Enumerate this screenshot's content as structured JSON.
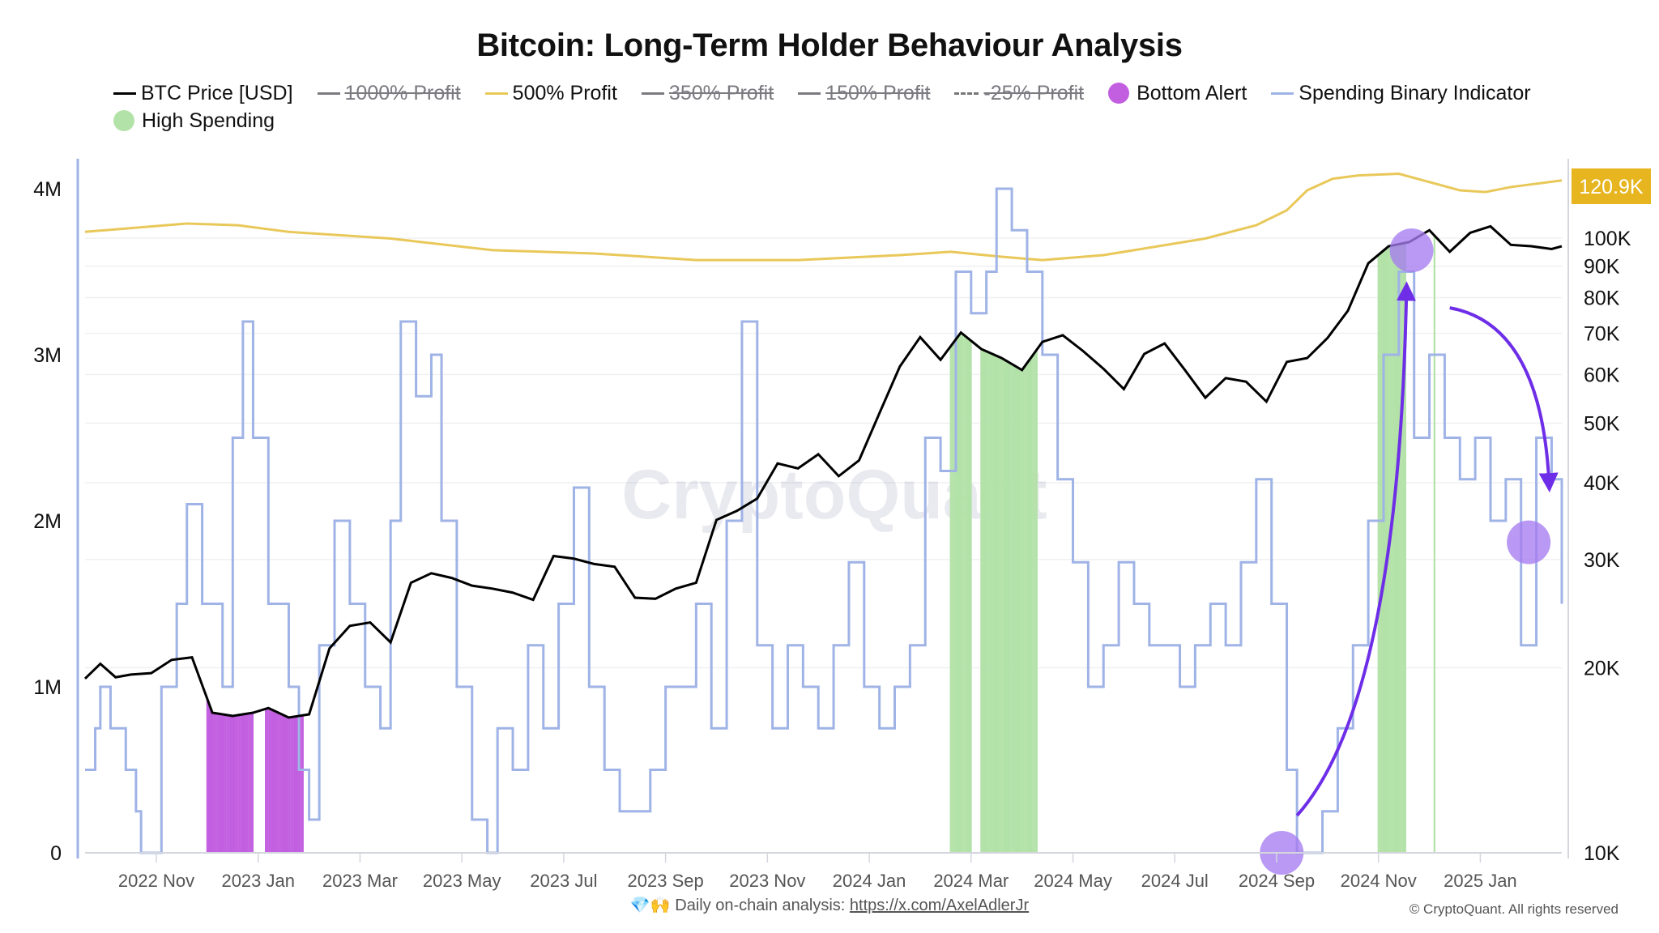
{
  "title": "Bitcoin: Long-Term Holder Behaviour Analysis",
  "legend": [
    {
      "label": "BTC Price [USD]",
      "style": "line",
      "color": "#000000",
      "active": true
    },
    {
      "label": "1000% Profit",
      "style": "line",
      "color": "#7a7a80",
      "active": false
    },
    {
      "label": "500% Profit",
      "style": "line",
      "color": "#e9c85a",
      "active": true
    },
    {
      "label": "350% Profit",
      "style": "line",
      "color": "#7a7a80",
      "active": false
    },
    {
      "label": "150% Profit",
      "style": "line",
      "color": "#7a7a80",
      "active": false
    },
    {
      "label": "-25% Profit",
      "style": "dashed",
      "color": "#7a7a80",
      "active": false
    },
    {
      "label": "Bottom Alert",
      "style": "dot",
      "color": "#c25ee0",
      "active": true
    },
    {
      "label": "Spending Binary Indicator",
      "style": "line",
      "color": "#9fb3e6",
      "active": true
    },
    {
      "label": "High Spending",
      "style": "dot",
      "color": "#b3e2a8",
      "active": true
    }
  ],
  "watermark": "CryptoQuant",
  "footer": {
    "emoji": "💎🙌",
    "text": "Daily on-chain analysis: ",
    "link_text": "https://x.com/AxelAdlerJr",
    "copyright": "© CryptoQuant. All rights reserved"
  },
  "price_badge": "120.9K",
  "colors": {
    "price": "#000000",
    "profit500": "#e9c85a",
    "spending": "#9fb3e6",
    "bottom_alert": "#c25ee0",
    "high_spending": "#b3e2a8",
    "annotation": "#6e2ee8",
    "annotation_circle": "#a57cf0",
    "badge": "#e6b51f"
  },
  "chart_data": {
    "type": "line",
    "title": "Bitcoin: Long-Term Holder Behaviour Analysis",
    "x_range": [
      "2022-09-20",
      "2025-02-20"
    ],
    "x_ticks": [
      "2022 Nov",
      "2023 Jan",
      "2023 Mar",
      "2023 May",
      "2023 Jul",
      "2023 Sep",
      "2023 Nov",
      "2024 Jan",
      "2024 Mar",
      "2024 May",
      "2024 Jul",
      "2024 Sep",
      "2024 Nov",
      "2025 Jan"
    ],
    "x_tick_months": [
      1.4,
      3.4,
      5.4,
      7.4,
      9.4,
      11.4,
      13.4,
      15.4,
      17.4,
      19.4,
      21.4,
      23.4,
      25.4,
      27.4
    ],
    "x_months_total": 29.0,
    "left_axis": {
      "label": "",
      "ticks": [
        "0",
        "1M",
        "2M",
        "3M",
        "4M"
      ],
      "tick_values": [
        0,
        1000000,
        2000000,
        3000000,
        4000000
      ],
      "range": [
        0,
        4000000
      ]
    },
    "right_axis": {
      "label": "",
      "scale": "log",
      "ticks": [
        "10K",
        "20K",
        "30K",
        "40K",
        "50K",
        "60K",
        "70K",
        "80K",
        "90K",
        "100K"
      ],
      "tick_values": [
        10000,
        20000,
        30000,
        40000,
        50000,
        60000,
        70000,
        80000,
        90000,
        100000
      ],
      "range": [
        10000,
        120000
      ]
    },
    "legend_position": "top",
    "series": [
      {
        "name": "BTC Price [USD]",
        "axis": "right",
        "x_months": [
          0.0,
          0.3,
          0.6,
          0.9,
          1.3,
          1.7,
          2.1,
          2.5,
          2.9,
          3.3,
          3.6,
          4.0,
          4.4,
          4.8,
          5.2,
          5.6,
          6.0,
          6.4,
          6.8,
          7.2,
          7.6,
          8.0,
          8.4,
          8.8,
          9.2,
          9.6,
          10.0,
          10.4,
          10.8,
          11.2,
          11.6,
          12.0,
          12.4,
          12.8,
          13.2,
          13.6,
          14.0,
          14.4,
          14.8,
          15.2,
          15.6,
          16.0,
          16.4,
          16.8,
          17.2,
          17.6,
          18.0,
          18.4,
          18.8,
          19.2,
          19.6,
          20.0,
          20.4,
          20.8,
          21.2,
          21.6,
          22.0,
          22.4,
          22.8,
          23.2,
          23.6,
          24.0,
          24.4,
          24.8,
          25.2,
          25.6,
          26.0,
          26.4,
          26.8,
          27.2,
          27.6,
          28.0,
          28.4,
          28.8,
          29.0
        ],
        "values": [
          19200,
          20300,
          19300,
          19500,
          19600,
          20600,
          20800,
          16900,
          16700,
          16900,
          17200,
          16600,
          16800,
          21500,
          23400,
          23700,
          22000,
          27500,
          28500,
          28000,
          27200,
          26900,
          26500,
          25800,
          30400,
          30100,
          29500,
          29200,
          26000,
          25900,
          26900,
          27500,
          34800,
          36000,
          37700,
          43000,
          42200,
          44500,
          41000,
          43500,
          51900,
          61800,
          69000,
          63400,
          70200,
          66000,
          63800,
          61000,
          67800,
          69500,
          65500,
          61300,
          56800,
          64800,
          67400,
          61000,
          55000,
          59200,
          58400,
          54200,
          62900,
          63800,
          68800,
          76200,
          91000,
          97000,
          98500,
          103000,
          95000,
          102000,
          104500,
          97500,
          97000,
          96000,
          97000
        ]
      },
      {
        "name": "500% Profit",
        "axis": "left",
        "x_months": [
          0,
          2,
          3,
          4,
          6,
          8,
          10,
          12,
          14,
          16,
          17,
          18,
          18.8,
          20,
          22,
          23,
          23.6,
          24,
          24.5,
          25,
          25.8,
          26.4,
          27,
          27.5,
          28,
          29
        ],
        "values": [
          3740000,
          3790000,
          3780000,
          3740000,
          3700000,
          3630000,
          3610000,
          3570000,
          3570000,
          3600000,
          3620000,
          3590000,
          3570000,
          3600000,
          3700000,
          3780000,
          3870000,
          3990000,
          4060000,
          4080000,
          4090000,
          4040000,
          3990000,
          3980000,
          4010000,
          4050000
        ]
      },
      {
        "name": "Spending Binary Indicator",
        "axis": "left",
        "x_months": [
          0.0,
          0.2,
          0.3,
          0.5,
          0.8,
          1.0,
          1.1,
          1.3,
          1.5,
          1.8,
          2.0,
          2.3,
          2.5,
          2.7,
          2.9,
          3.1,
          3.3,
          3.5,
          3.6,
          3.8,
          4.0,
          4.2,
          4.4,
          4.6,
          4.9,
          5.2,
          5.5,
          5.8,
          6.0,
          6.2,
          6.5,
          6.8,
          7.0,
          7.3,
          7.6,
          7.9,
          8.1,
          8.4,
          8.7,
          9.0,
          9.3,
          9.6,
          9.9,
          10.2,
          10.5,
          10.8,
          11.1,
          11.4,
          11.7,
          12.0,
          12.3,
          12.6,
          12.9,
          13.2,
          13.5,
          13.8,
          14.1,
          14.4,
          14.7,
          15.0,
          15.3,
          15.6,
          15.9,
          16.2,
          16.5,
          16.8,
          17.1,
          17.4,
          17.7,
          17.9,
          18.2,
          18.5,
          18.8,
          19.1,
          19.4,
          19.7,
          20.0,
          20.3,
          20.6,
          20.9,
          21.2,
          21.5,
          21.8,
          22.1,
          22.4,
          22.7,
          23.0,
          23.3,
          23.6,
          23.8,
          24.0,
          24.3,
          24.6,
          24.9,
          25.2,
          25.5,
          25.8,
          26.1,
          26.4,
          26.7,
          27.0,
          27.3,
          27.6,
          27.9,
          28.2,
          28.5,
          28.8,
          29.0
        ],
        "values": [
          500000,
          750000,
          1000000,
          750000,
          500000,
          250000,
          0,
          0,
          1000000,
          1500000,
          2100000,
          1500000,
          1500000,
          1000000,
          2500000,
          3200000,
          2500000,
          2500000,
          1500000,
          1500000,
          1000000,
          500000,
          200000,
          1250000,
          2000000,
          1500000,
          1000000,
          750000,
          2000000,
          3200000,
          2750000,
          3000000,
          2000000,
          1000000,
          200000,
          0,
          750000,
          500000,
          1250000,
          750000,
          1500000,
          2200000,
          1000000,
          500000,
          250000,
          250000,
          500000,
          1000000,
          1000000,
          1500000,
          750000,
          2000000,
          3200000,
          1250000,
          750000,
          1250000,
          1000000,
          750000,
          1250000,
          1750000,
          1000000,
          750000,
          1000000,
          1250000,
          2500000,
          2300000,
          3500000,
          3250000,
          3500000,
          4000000,
          3750000,
          3500000,
          3000000,
          2250000,
          1750000,
          1000000,
          1250000,
          1750000,
          1500000,
          1250000,
          1250000,
          1000000,
          1250000,
          1500000,
          1250000,
          1750000,
          2250000,
          1500000,
          500000,
          0,
          0,
          250000,
          750000,
          1250000,
          2000000,
          3000000,
          3500000,
          2500000,
          3000000,
          2500000,
          2250000,
          2500000,
          2000000,
          2250000,
          1250000,
          2500000,
          2250000,
          1500000
        ]
      }
    ],
    "bottom_alert_bars": {
      "ranges_months": [
        [
          2.4,
          3.3
        ],
        [
          3.55,
          4.3
        ]
      ],
      "value": "price"
    },
    "high_spending_bars": {
      "ranges_months": [
        [
          17.0,
          17.4
        ],
        [
          17.6,
          18.7
        ],
        [
          25.4,
          25.95
        ],
        [
          26.5,
          26.52
        ]
      ],
      "value": "price"
    },
    "annotations": [
      {
        "type": "circle",
        "x_month": 26.05,
        "price": 95500,
        "label": "top"
      },
      {
        "type": "circle",
        "x_month": 23.5,
        "price": 10000,
        "label": "bottom"
      },
      {
        "type": "circle",
        "x_month": 28.35,
        "price": 32000,
        "label": "bottom"
      },
      {
        "type": "arrow",
        "from": [
          23.8,
          11500
        ],
        "to": [
          25.95,
          82000
        ],
        "direction": "up"
      },
      {
        "type": "arrow",
        "from": [
          26.8,
          77000
        ],
        "to": [
          28.75,
          40000
        ],
        "direction": "down"
      }
    ]
  }
}
